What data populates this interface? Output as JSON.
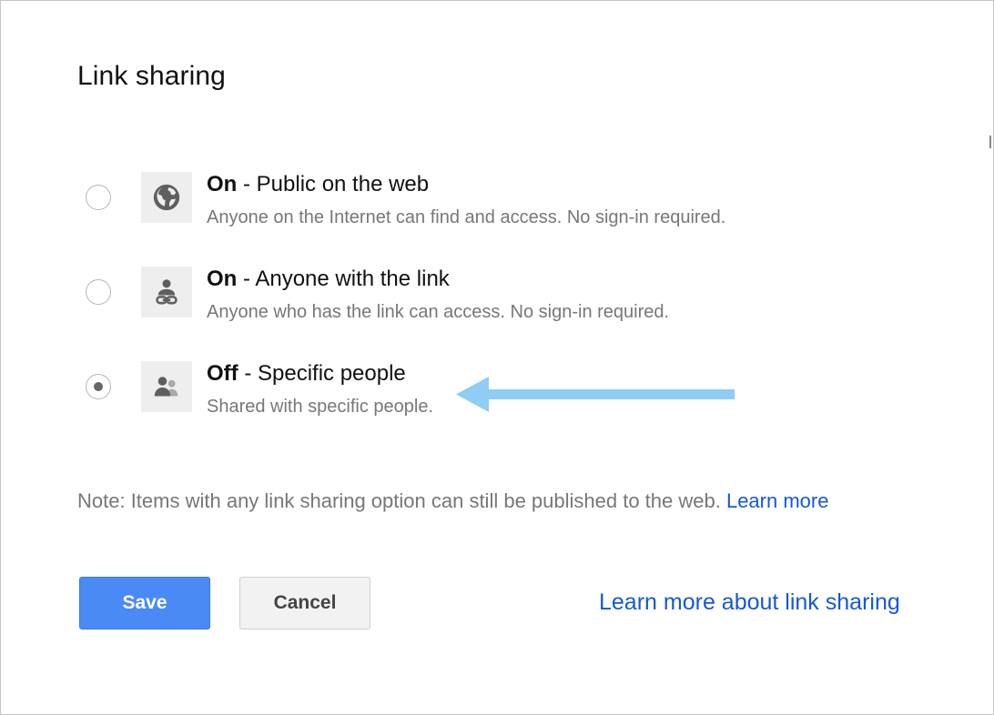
{
  "dialog": {
    "title": "Link sharing",
    "options": [
      {
        "state": "On",
        "sep": " - ",
        "title": "Public on the web",
        "desc": "Anyone on the Internet can find and access. No sign-in required.",
        "icon": "globe-icon",
        "selected": false
      },
      {
        "state": "On",
        "sep": " - ",
        "title": "Anyone with the link",
        "desc": "Anyone who has the link can access. No sign-in required.",
        "icon": "person-link-icon",
        "selected": false
      },
      {
        "state": "Off",
        "sep": " - ",
        "title": "Specific people",
        "desc": "Shared with specific people.",
        "icon": "people-icon",
        "selected": true
      }
    ],
    "note": {
      "text": "Note: Items with any link sharing option can still be published to the web. ",
      "link": "Learn more"
    },
    "buttons": {
      "save": "Save",
      "cancel": "Cancel"
    },
    "learn_more_link": "Learn more about link sharing",
    "annotation_arrow": {
      "icon": "left-arrow-icon",
      "color": "#8ecdf4"
    },
    "colors": {
      "accent": "#4a8af4",
      "link": "#1558d6",
      "muted_text": "#777777"
    }
  }
}
